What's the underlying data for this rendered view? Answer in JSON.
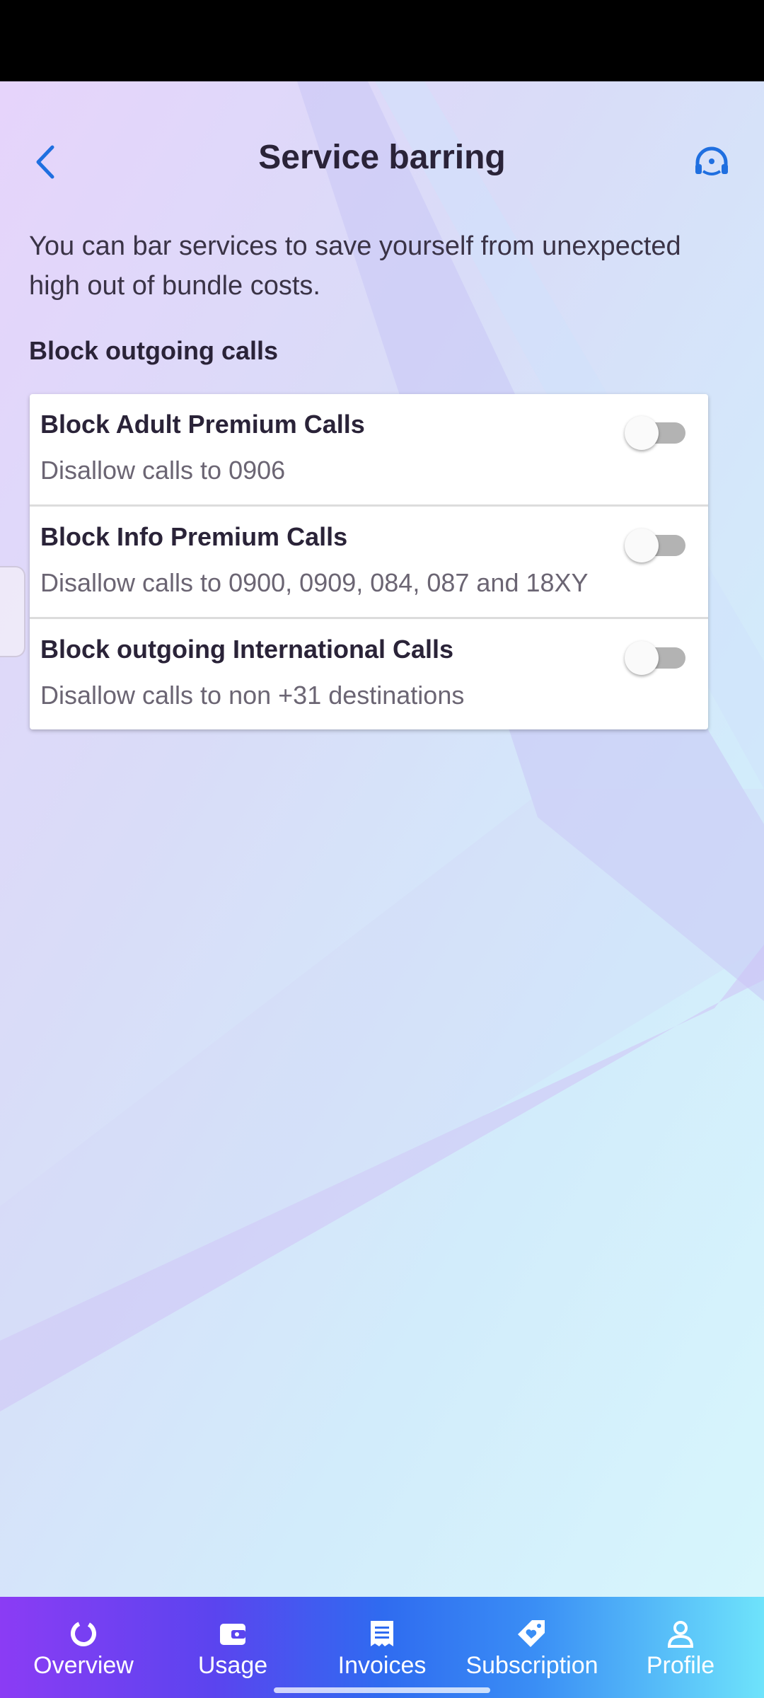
{
  "header": {
    "title": "Service barring",
    "back_icon": "chevron-left-icon",
    "support_icon": "headset-icon"
  },
  "intro_text": "You can bar services to save yourself from unexpected high out of bundle costs.",
  "section_title": "Block outgoing calls",
  "options": [
    {
      "title": "Block Adult Premium Calls",
      "subtitle": "Disallow calls to 0906",
      "enabled": false
    },
    {
      "title": "Block Info Premium Calls",
      "subtitle": "Disallow calls to 0900, 0909, 084, 087 and 18XY",
      "enabled": false
    },
    {
      "title": "Block outgoing International Calls",
      "subtitle": "Disallow calls to non +31 destinations",
      "enabled": false
    }
  ],
  "nav": {
    "items": [
      {
        "label": "Overview",
        "icon": "overview-icon"
      },
      {
        "label": "Usage",
        "icon": "wallet-icon"
      },
      {
        "label": "Invoices",
        "icon": "invoice-icon"
      },
      {
        "label": "Subscription",
        "icon": "tag-icon"
      },
      {
        "label": "Profile",
        "icon": "person-icon"
      }
    ]
  },
  "colors": {
    "accent": "#1f6fe0",
    "text_dark": "#2a2338",
    "toggle_off_track": "#b3b3b3"
  }
}
